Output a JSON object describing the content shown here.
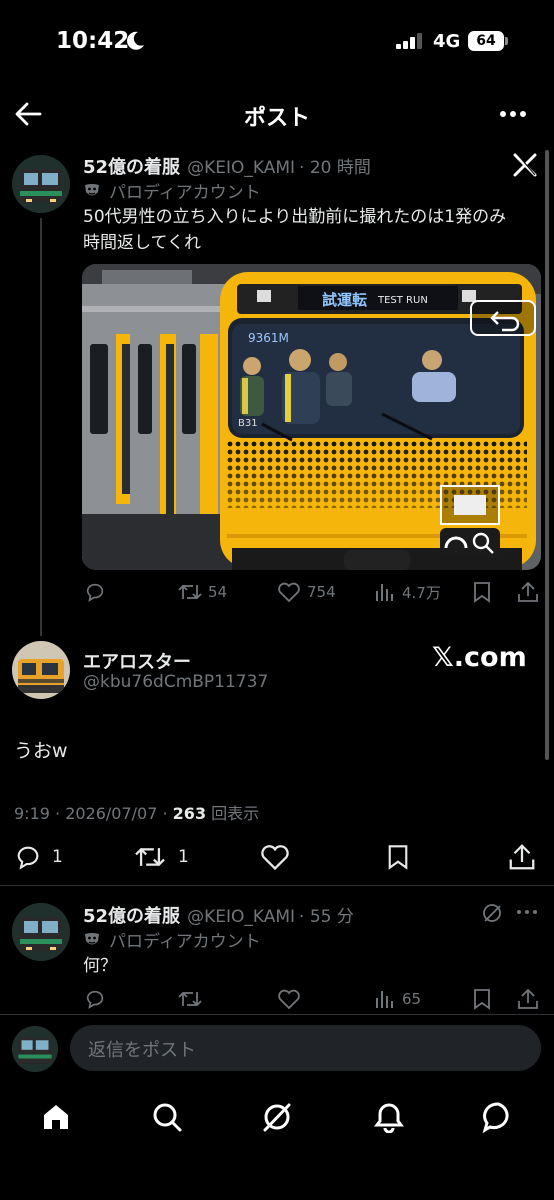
{
  "status_bar": {
    "time": "10:42",
    "network": "4G",
    "battery": "64"
  },
  "header": {
    "title": "ポスト"
  },
  "post1": {
    "name": "52億の着服",
    "handle": "@KEIO_KAMI",
    "time": "· 20 時間",
    "parody_label": "パロディアカウント",
    "text_line1": "50代男性の立ち入りにより出勤前に撮れたのは1発のみ",
    "text_line2": "時間返してくれ",
    "media": {
      "display_sign": "試運転",
      "display_sub": "TEST RUN",
      "train_number": "9361M",
      "car_code": "B31"
    },
    "reply_count": "",
    "repost_count": "54",
    "like_count": "754",
    "view_count": "4.7万"
  },
  "main_post": {
    "name": "エアロスター",
    "handle": "@kbu76dCmBP11737",
    "watermark": "𝕏.com",
    "text": "うおw",
    "meta_time": "9:19 · 2026/07/07 · ",
    "meta_views": "263",
    "meta_views_label": " 回表示",
    "reply_count": "1",
    "repost_count": "1"
  },
  "post3": {
    "name": "52億の着服",
    "handle": "@KEIO_KAMI",
    "time": "· 55 分",
    "parody_label": "パロディアカウント",
    "text": "何？",
    "view_count": "65"
  },
  "reply_bar": {
    "placeholder": "返信をポスト"
  },
  "icons": {
    "header": [
      "back-arrow-icon",
      "more-icon"
    ],
    "actions": [
      "reply-icon",
      "repost-icon",
      "like-icon",
      "views-icon",
      "bookmark-icon",
      "share-icon"
    ],
    "nav": [
      "home-icon",
      "search-icon",
      "grok-icon",
      "notifications-icon",
      "messages-icon"
    ]
  },
  "colors": {
    "background": "#000000",
    "text": "#e7e9ea",
    "muted": "#71767b",
    "separator": "#2f3336",
    "train_yellow": "#f5b50a"
  }
}
